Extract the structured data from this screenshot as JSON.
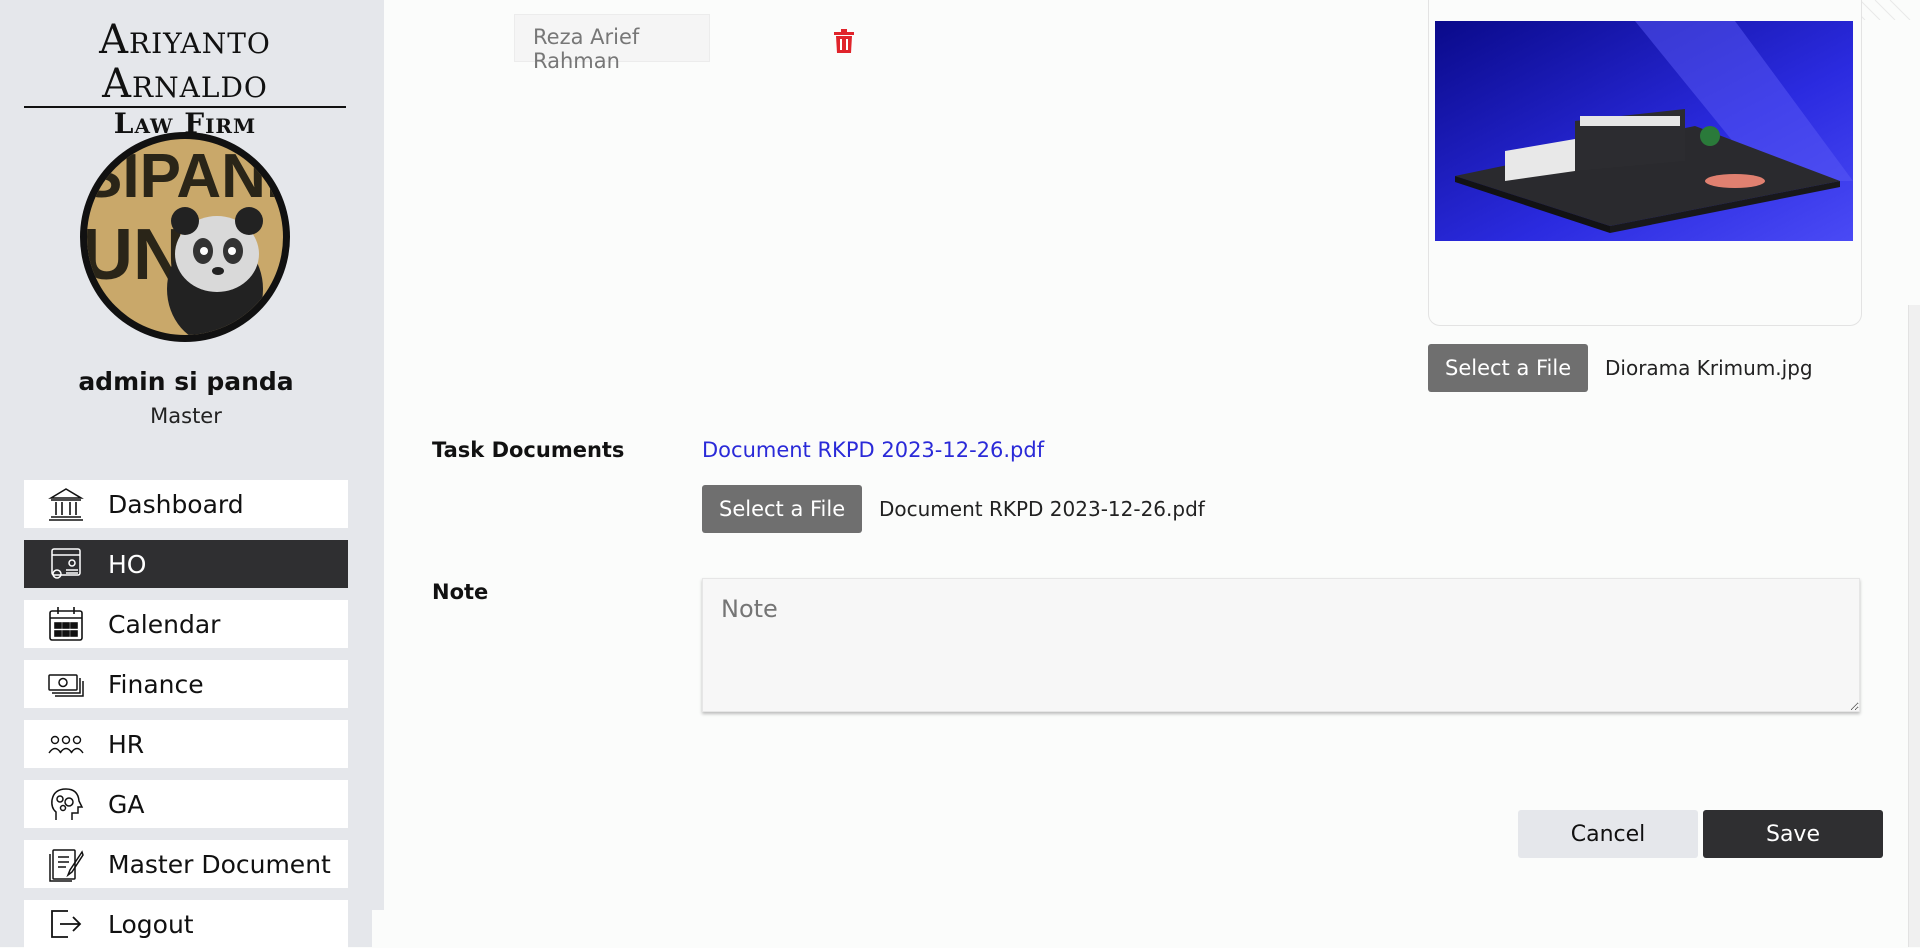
{
  "sidebar": {
    "brand_line1": "Ariyanto Arnaldo",
    "brand_line2": "Law Firm",
    "avatar_text_top": "SIPANDA",
    "avatar_text_bottom": "UNIK",
    "user_name": "admin si panda",
    "user_role": "Master",
    "items": [
      {
        "label": "Dashboard",
        "icon": "bank-icon",
        "active": false
      },
      {
        "label": "HO",
        "icon": "office-settings-icon",
        "active": true
      },
      {
        "label": "Calendar",
        "icon": "calendar-icon",
        "active": false
      },
      {
        "label": "Finance",
        "icon": "money-icon",
        "active": false
      },
      {
        "label": "HR",
        "icon": "people-icon",
        "active": false
      },
      {
        "label": "GA",
        "icon": "head-gears-icon",
        "active": false
      },
      {
        "label": "Master Document",
        "icon": "document-edit-icon",
        "active": false
      },
      {
        "label": "Logout",
        "icon": "logout-icon",
        "active": false
      }
    ]
  },
  "form": {
    "assignee_value": "Reza Arief Rahman",
    "image_file_button": "Select a File",
    "image_file_name": "Diorama Krimum.jpg",
    "task_documents_label": "Task Documents",
    "task_document_link": "Document RKPD 2023-12-26.pdf",
    "document_file_button": "Select a File",
    "document_file_name": "Document RKPD 2023-12-26.pdf",
    "note_label": "Note",
    "note_placeholder": "Note",
    "cancel_label": "Cancel",
    "save_label": "Save"
  },
  "colors": {
    "sidebar_bg": "#e5e7eb",
    "active_nav": "#2f2f31",
    "link": "#2a2ad8",
    "trash": "#e0242b",
    "file_button": "#6f6f6f"
  }
}
